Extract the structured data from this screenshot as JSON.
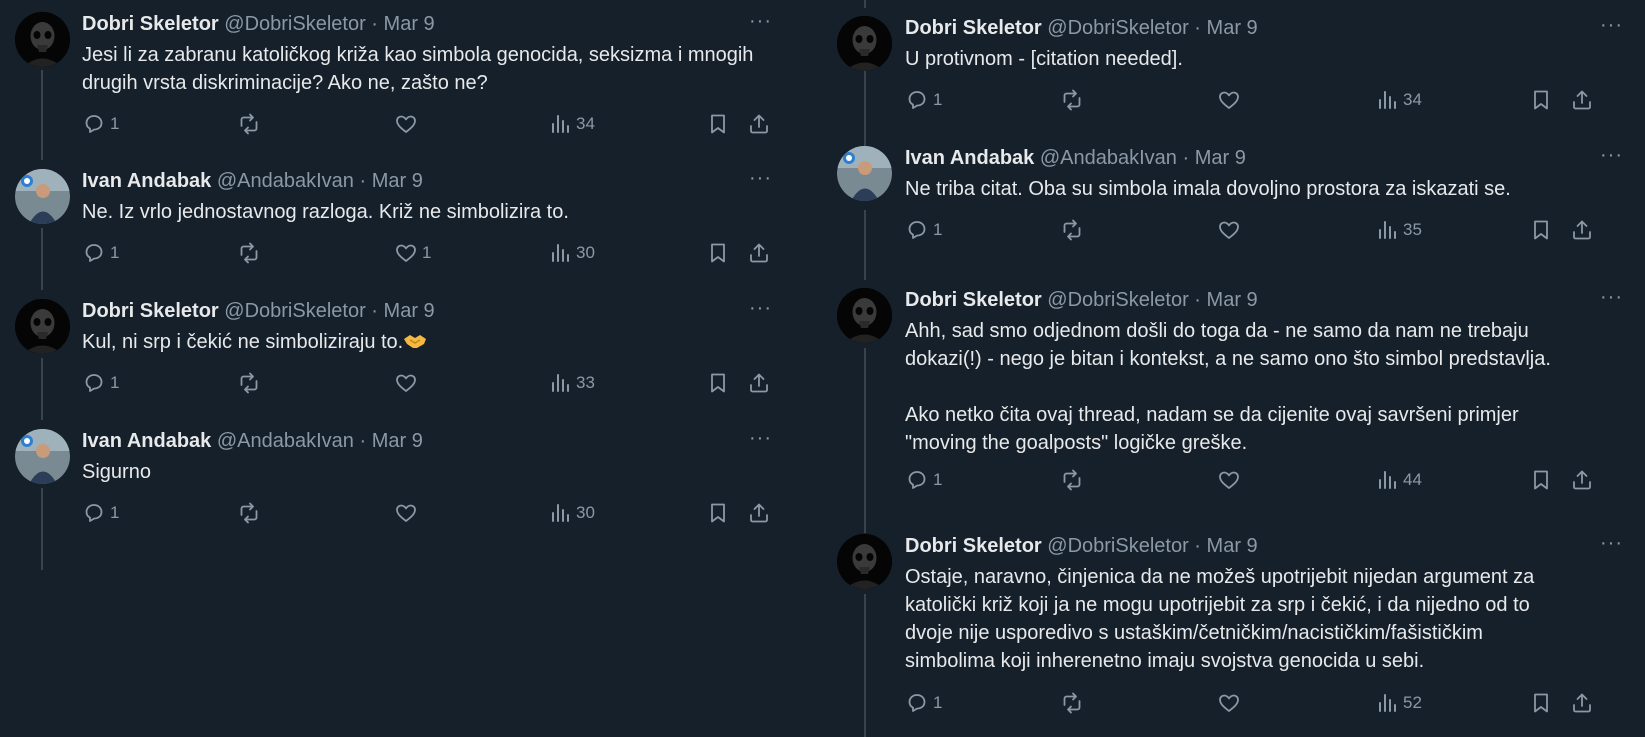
{
  "left": {
    "tweets": [
      {
        "avatar": "skeleton-avatar",
        "name": "Dobri Skeletor",
        "handle": "@DobriSkeletor",
        "sep": "·",
        "date": "Mar 9",
        "text": "Jesi li za zabranu katoličkog križa kao simbola genocida, seksizma i mnogih\ndrugih vrsta diskriminacije? Ako ne, zašto ne?",
        "reply_count": "1",
        "retweet_count": "",
        "like_count": "",
        "view_count": "34"
      },
      {
        "avatar": "ivan-avatar",
        "name": "Ivan Andabak",
        "handle": "@AndabakIvan",
        "sep": "·",
        "date": "Mar 9",
        "text": "Ne. Iz vrlo jednostavnog razloga. Križ ne simbolizira to.",
        "reply_count": "1",
        "retweet_count": "",
        "like_count": "1",
        "view_count": "30"
      },
      {
        "avatar": "skeleton-avatar",
        "name": "Dobri Skeletor",
        "handle": "@DobriSkeletor",
        "sep": "·",
        "date": "Mar 9",
        "text": "Kul, ni srp i čekić ne simboliziraju to.",
        "emoji": "handshake-emoji",
        "reply_count": "1",
        "retweet_count": "",
        "like_count": "",
        "view_count": "33"
      },
      {
        "avatar": "ivan-avatar",
        "name": "Ivan Andabak",
        "handle": "@AndabakIvan",
        "sep": "·",
        "date": "Mar 9",
        "text": "Sigurno",
        "reply_count": "1",
        "retweet_count": "",
        "like_count": "",
        "view_count": "30"
      }
    ]
  },
  "right": {
    "tweets": [
      {
        "avatar": "skeleton-avatar",
        "name": "Dobri Skeletor",
        "handle": "@DobriSkeletor",
        "sep": "·",
        "date": "Mar 9",
        "text": "U protivnom - [citation needed].",
        "reply_count": "1",
        "retweet_count": "",
        "like_count": "",
        "view_count": "34"
      },
      {
        "avatar": "ivan-avatar",
        "name": "Ivan Andabak",
        "handle": "@AndabakIvan",
        "sep": "·",
        "date": "Mar 9",
        "text": "Ne triba citat. Oba su simbola imala dovoljno prostora za iskazati se.",
        "reply_count": "1",
        "retweet_count": "",
        "like_count": "",
        "view_count": "35"
      },
      {
        "avatar": "skeleton-avatar",
        "name": "Dobri Skeletor",
        "handle": "@DobriSkeletor",
        "sep": "·",
        "date": "Mar 9",
        "text": "Ahh, sad smo odjednom došli do toga da - ne samo da nam ne trebaju\ndokazi(!) - nego je bitan i kontekst, a ne samo ono što simbol predstavlja.\n\nAko netko čita ovaj thread, nadam se da cijenite ovaj savršeni primjer\n\"moving the goalposts\" logičke greške.",
        "reply_count": "1",
        "retweet_count": "",
        "like_count": "",
        "view_count": "44"
      },
      {
        "avatar": "skeleton-avatar",
        "name": "Dobri Skeletor",
        "handle": "@DobriSkeletor",
        "sep": "·",
        "date": "Mar 9",
        "text": "Ostaje, naravno, činjenica da ne možeš upotrijebit nijedan argument za\nkatolički križ koji ja ne mogu upotrijebit za srp i čekić, i da nijedno od to\ndvoje nije usporedivo s ustaškim/četničkim/nacističkim/fašističkim\nsimbolima koji inherenetno imaju svojstva genocida u sebi.",
        "reply_count": "1",
        "retweet_count": "",
        "like_count": "",
        "view_count": "52"
      }
    ]
  },
  "icons": {
    "reply": "reply-icon",
    "retweet": "retweet-icon",
    "like": "like-icon",
    "views": "views-icon",
    "bookmark": "bookmark-icon",
    "share": "share-icon",
    "more": "more-icon"
  },
  "colors": {
    "background": "#15202b",
    "text": "#e7e9ea",
    "muted": "#8b98a5",
    "thread_line": "#38444d"
  },
  "more_label": "···"
}
